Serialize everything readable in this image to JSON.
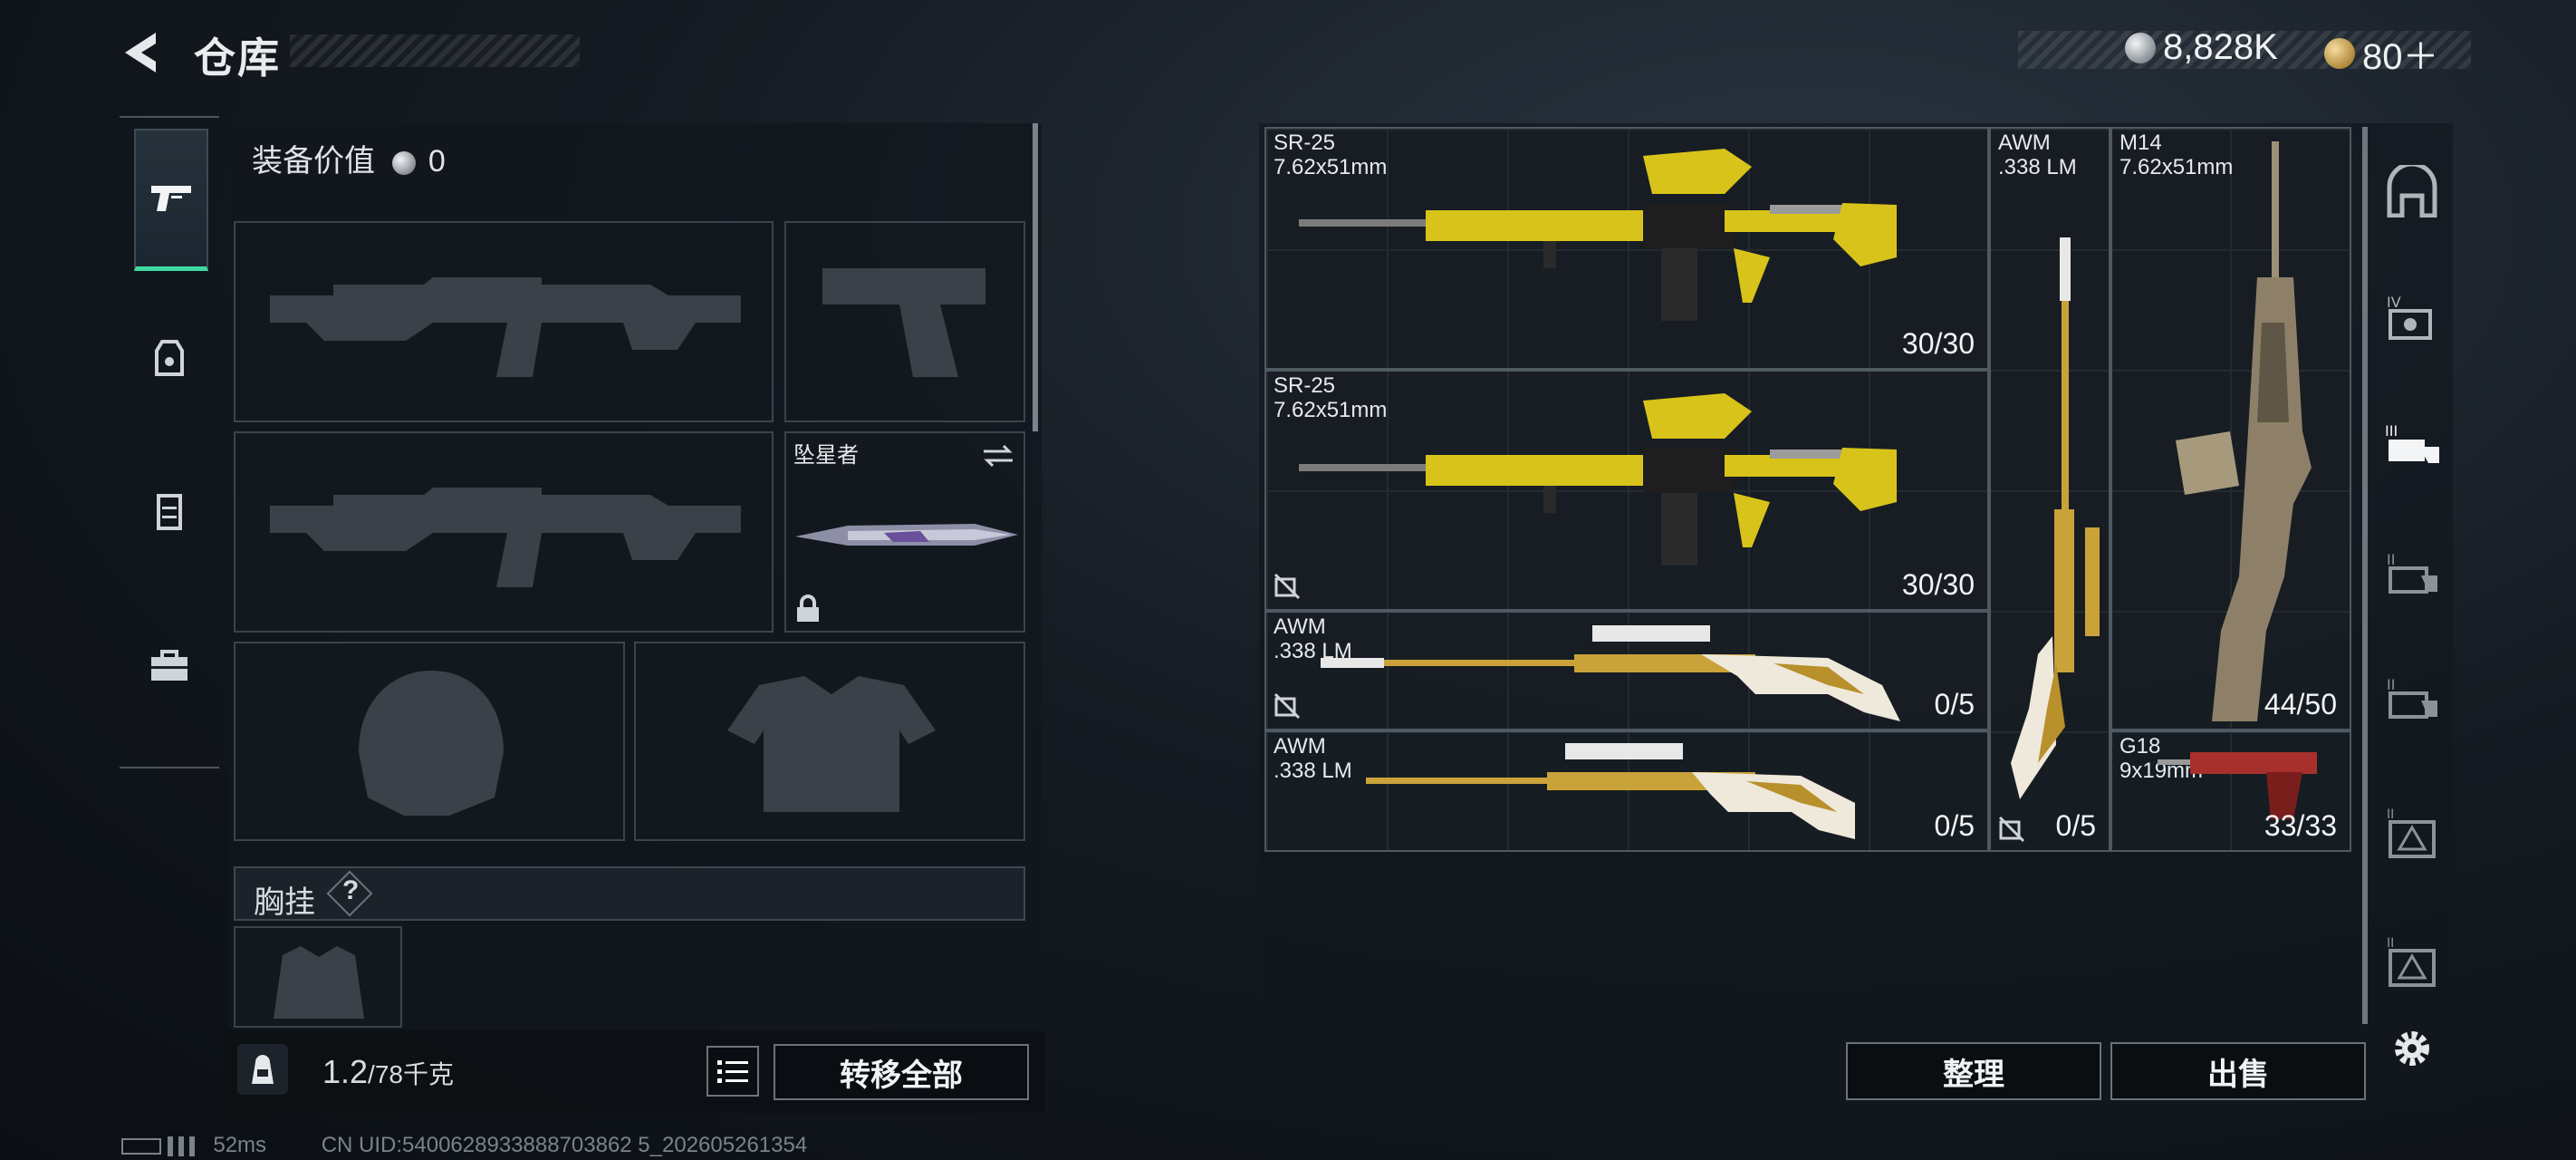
{
  "header": {
    "title": "仓库",
    "silver_amount": "8,828K",
    "gold_amount": "80＋"
  },
  "rail": {
    "items": [
      {
        "name": "weapons",
        "icon": "pistol-icon",
        "active": true
      },
      {
        "name": "helmet",
        "icon": "helmet-icon",
        "active": false
      },
      {
        "name": "armor",
        "icon": "vest-icon",
        "active": false
      },
      {
        "name": "toolbox",
        "icon": "toolbox-icon",
        "active": false
      }
    ]
  },
  "equipment": {
    "value_label": "装备价值",
    "value": "0",
    "melee_name": "坠星者",
    "chest_label": "胸挂",
    "chest_help": "?"
  },
  "bottom": {
    "weight": "1.2",
    "weight_cap": "/78千克",
    "transfer_all": "转移全部"
  },
  "stash": {
    "items": [
      {
        "name": "SR-25",
        "caliber": "7.62x51mm",
        "ammo": "30/30",
        "color": "#d8c31a"
      },
      {
        "name": "SR-25",
        "caliber": "7.62x51mm",
        "ammo": "30/30",
        "color": "#d8c31a"
      },
      {
        "name": "AWM",
        "caliber": ".338 LM",
        "ammo": "0/5",
        "color": "#c9a23a"
      },
      {
        "name": "AWM",
        "caliber": ".338 LM",
        "ammo": "0/5",
        "color": "#c9a23a"
      },
      {
        "name": "AWM",
        "caliber": ".338 LM",
        "ammo": "0/5",
        "color": "#c9a23a"
      },
      {
        "name": "M14",
        "caliber": "7.62x51mm",
        "ammo": "44/50",
        "color": "#9a8f78"
      },
      {
        "name": "G18",
        "caliber": "9x19mm",
        "ammo": "33/33",
        "color": "#a8302c"
      }
    ],
    "sort_label": "整理",
    "sell_label": "出售"
  },
  "footer": {
    "ping": "52ms",
    "uid": "CN UID:5400628933888703862 5_202605261354"
  }
}
